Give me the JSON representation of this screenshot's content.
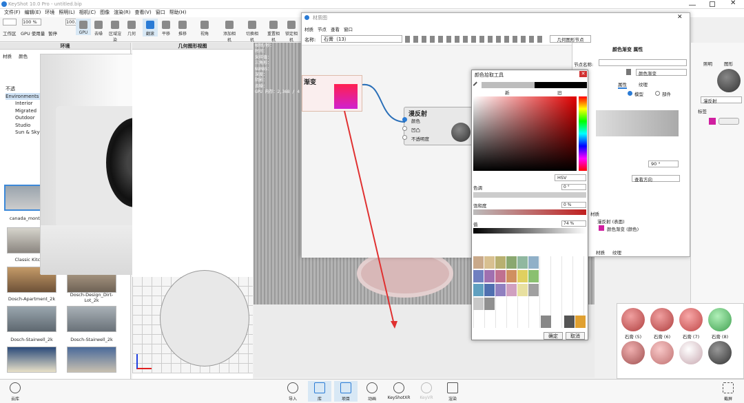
{
  "app": {
    "title": "KeyShot 10.0 Pro - untitled.bip"
  },
  "menu": [
    "文件(F)",
    "编辑(E)",
    "环境",
    "照明(L)",
    "相机(C)",
    "图像",
    "渲染(R)",
    "查看(V)",
    "窗口",
    "帮助(H)"
  ],
  "toolbar": {
    "workspace": "工作区",
    "gpu": "GPU 使用量",
    "pause": "暂停",
    "cpu": "CPU",
    "zoom": "100 %",
    "view": "100.0",
    "gpu_btn": "GPU",
    "denoise": "去噪",
    "region": "区域渲染",
    "geometry": "几何",
    "flip": "翻滚",
    "pan": "平移",
    "dolly": "推移",
    "fov": "视角",
    "add_camera": "添加相机",
    "switch_camera": "切换相机",
    "reset_camera": "重置相机",
    "lock_camera": "锁定相机"
  },
  "env_panel": {
    "title": "环境",
    "tabs": [
      "材质",
      "颜色"
    ],
    "tree": [
      "不透",
      "Environments",
      "Interior",
      "Migrated",
      "Outdoor",
      "Studio",
      "Sun & Sky"
    ],
    "thumbs": [
      "canada_montreal",
      "Classic Kitchen",
      "Dosch-Apartment_2k",
      "Dosch-Design_Dirt-Lot_2k",
      "Dosch-Stairwell_2k",
      "Dosch-Stairwell_2k"
    ]
  },
  "geo_view": {
    "title": "几何图形视图"
  },
  "stats": {
    "lines": [
      "帧频/秒：",
      "时间：",
      "采样值：",
      "三角形：",
      "NURBS：",
      "深度：",
      "阴影：",
      "去噪：",
      "GPU 内存：2,368 / 4"
    ]
  },
  "mat_editor": {
    "title": "材质图",
    "menu": [
      "材质",
      "节点",
      "查看",
      "窗口"
    ],
    "name_label": "名称:",
    "name_value": "石膏（13）",
    "geo_btn": "几何图形节点",
    "node1": "渐变",
    "node2": "漫反射",
    "ports": [
      "颜色",
      "凹凸",
      "不透明度"
    ]
  },
  "color_picker": {
    "title": "颜色拾取工具",
    "new": "新",
    "old": "旧",
    "mode": "HSV",
    "hue_label": "色调",
    "hue": "0 °",
    "sat_label": "饱和度",
    "sat": "0 %",
    "val_label": "值",
    "val": "74 %",
    "ok": "确定",
    "cancel": "取消"
  },
  "props": {
    "title": "颜色渐变 属性",
    "node_name": "节点名称:",
    "type": "颜色渐变",
    "tabs": [
      "属性",
      "纹理"
    ],
    "model": "模型",
    "part": "部件",
    "angle": "90 °",
    "dir": "查看方向",
    "material": "材质",
    "tree1": "漫反射 (表面)",
    "tree2": "颜色渐变 (颜色)",
    "bottom_tabs": [
      "材质",
      "纹理"
    ],
    "diffuse": "漫反射",
    "label": "标签"
  },
  "right_panel": {
    "tabs": [
      "照明",
      "图形"
    ]
  },
  "library": {
    "balls": [
      "石膏 (5)",
      "石膏 (6)",
      "石膏 (7)",
      "石膏 (8)"
    ]
  },
  "bottom": {
    "left": "云库",
    "items": [
      "导入",
      "库",
      "项目",
      "动画",
      "KeyShotXR",
      "KeyVR",
      "渲染"
    ],
    "right": "截屏"
  }
}
